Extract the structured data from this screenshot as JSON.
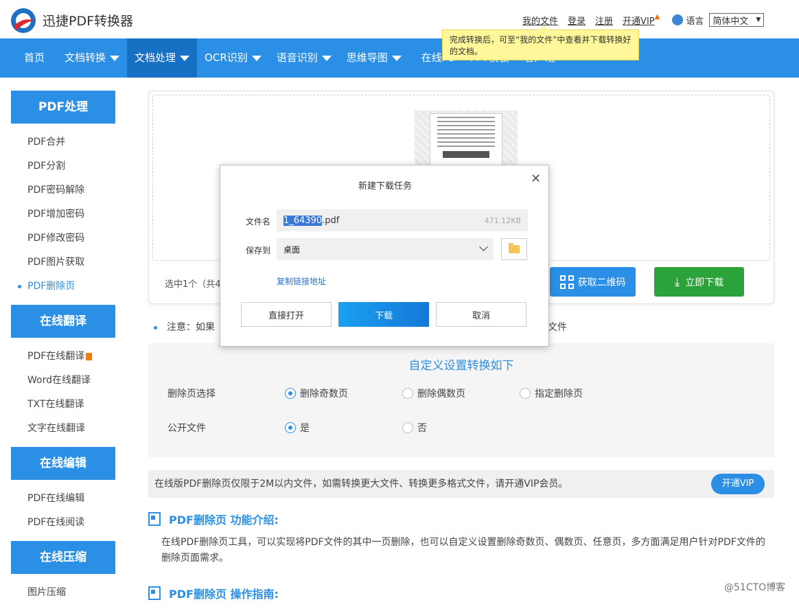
{
  "header": {
    "brand": "迅捷PDF转换器",
    "links": [
      "我的文件",
      "登录",
      "注册",
      "开通VIP"
    ],
    "lang_label": "语言",
    "lang_value": "简体中文",
    "tooltip": "完成转换后，可至“我的文件”中查看并下载转换好的文档。"
  },
  "nav": [
    "首页",
    "文档转换",
    "文档处理",
    "OCR识别",
    "语音识别",
    "思维导图",
    "在线PS",
    "PPT模板",
    "客户端"
  ],
  "sidebar": [
    {
      "title": "PDF处理",
      "items": [
        "PDF合并",
        "PDF分割",
        "PDF密码解除",
        "PDF增加密码",
        "PDF修改密码",
        "PDF图片获取",
        "PDF删除页"
      ]
    },
    {
      "title": "在线翻译",
      "items": [
        "PDF在线翻译",
        "Word在线翻译",
        "TXT在线翻译",
        "文字在线翻译"
      ]
    },
    {
      "title": "在线编辑",
      "items": [
        "PDF在线编辑",
        "PDF在线阅读"
      ]
    },
    {
      "title": "在线压缩",
      "items": [
        "图片压缩"
      ]
    }
  ],
  "main": {
    "selected": "选中1个（共4",
    "qr_button": "获取二维码",
    "download_button": "立即下载",
    "note_start": "注意：如果",
    "note_end": "文件"
  },
  "settings": {
    "title": "自定义设置转换如下",
    "row1_label": "删除页选择",
    "row1_options": [
      "删除奇数页",
      "删除偶数页",
      "指定删除页"
    ],
    "row2_label": "公开文件",
    "row2_options": [
      "是",
      "否"
    ]
  },
  "vip": {
    "text": "在线版PDF删除页仅限于2M以内文件，如需转换更大文件、转换更多格式文件，请开通VIP会员。",
    "button": "开通VIP"
  },
  "intro": {
    "title": "PDF删除页 功能介绍:",
    "body": "在线PDF删除页工具，可以实现将PDF文件的其中一页删除，也可以自定义设置删除奇数页、偶数页、任意页，多方面满足用户针对PDF文件的删除页面需求。",
    "guide_title": "PDF删除页 操作指南:"
  },
  "watermark": "@51CTO博客",
  "modal": {
    "title": "新建下载任务",
    "filename_label": "文件名",
    "filename_selected": "1_64390",
    "filename_ext": ".pdf",
    "filesize": "471.12KB",
    "saveto_label": "保存到",
    "saveto_value": "桌面",
    "copy_link": "复制链接地址",
    "btn_open": "直接打开",
    "btn_download": "下载",
    "btn_cancel": "取消"
  }
}
